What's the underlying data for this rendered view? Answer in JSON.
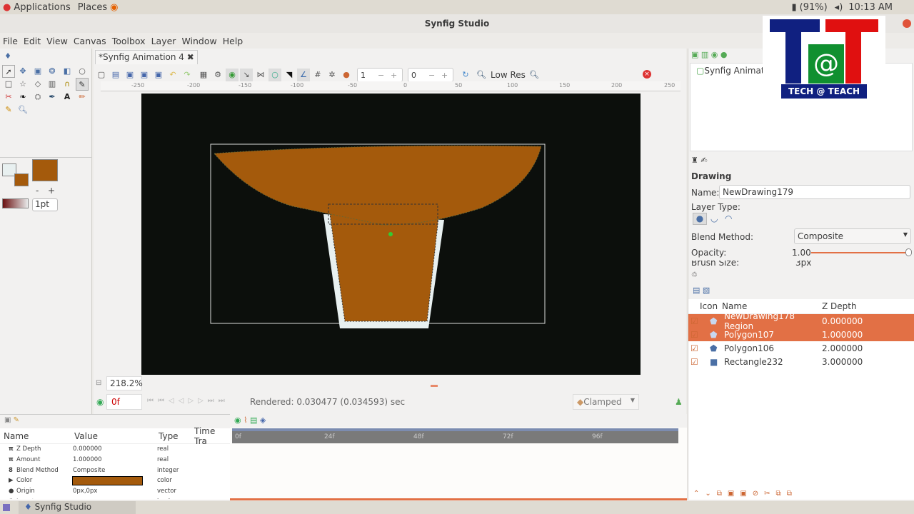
{
  "top_panel": {
    "applications": "Applications",
    "places": "Places",
    "battery": "(91%)",
    "time": "10:13 AM"
  },
  "window_title": "Synfig Studio",
  "menu": [
    "File",
    "Edit",
    "View",
    "Canvas",
    "Toolbox",
    "Layer",
    "Window",
    "Help"
  ],
  "toolbox": {
    "brush_size": "1pt",
    "minus": "-",
    "plus": "+"
  },
  "canvas": {
    "tab_title": "*Synfig Animation 4",
    "frame_start": "1",
    "frame_end": "0",
    "render_quality": "Low Res",
    "ruler_ticks": [
      "-250",
      "-200",
      "-150",
      "-100",
      "-50",
      "0",
      "50",
      "100",
      "150",
      "200",
      "250"
    ],
    "zoom": "218.2%",
    "current_time": "0f",
    "status": "Rendered: 0.030477 (0.034593) sec",
    "interpolation": "Clamped",
    "colors": {
      "fill": "#a45a0c",
      "background": "#0c0f0c",
      "outline": "#e8f0f0"
    }
  },
  "canvas_browser": {
    "item": "Synfig Animati"
  },
  "logo": {
    "text": "TECH @ TEACH"
  },
  "tool_options": {
    "heading": "Drawing",
    "name_label": "Name:",
    "name_value": "NewDrawing179",
    "layer_type_label": "Layer Type:",
    "blend_label": "Blend Method:",
    "blend_value": "Composite",
    "opacity_label": "Opacity:",
    "opacity_value": "1.00",
    "opacity": 1.0,
    "brush_label": "Brush Size:",
    "brush_value": "3px"
  },
  "layers": {
    "headers": [
      "Icon",
      "Name",
      "Z Depth"
    ],
    "rows": [
      {
        "name": "NewDrawing178 Region",
        "z": "0.000000",
        "selected": true
      },
      {
        "name": "Polygon107",
        "z": "1.000000",
        "selected": true
      },
      {
        "name": "Polygon106",
        "z": "2.000000",
        "selected": false
      },
      {
        "name": "Rectangle232",
        "z": "3.000000",
        "selected": false
      }
    ]
  },
  "params": {
    "headers": [
      "Name",
      "Value",
      "Type",
      "Time Tra"
    ],
    "rows": [
      {
        "name": "Z Depth",
        "value": "0.000000",
        "type": "real"
      },
      {
        "name": "Amount",
        "value": "1.000000",
        "type": "real"
      },
      {
        "name": "Blend Method",
        "value": "Composite",
        "type": "integer"
      },
      {
        "name": "Color",
        "value": "",
        "type": "color"
      },
      {
        "name": "Origin",
        "value": "0px,0px",
        "type": "vector"
      },
      {
        "name": "Invert",
        "value": "",
        "type": "bool"
      }
    ]
  },
  "timetrack": {
    "ticks": [
      "0f",
      "24f",
      "48f",
      "72f",
      "96f"
    ]
  },
  "taskbar": {
    "app": "Synfig Studio"
  }
}
